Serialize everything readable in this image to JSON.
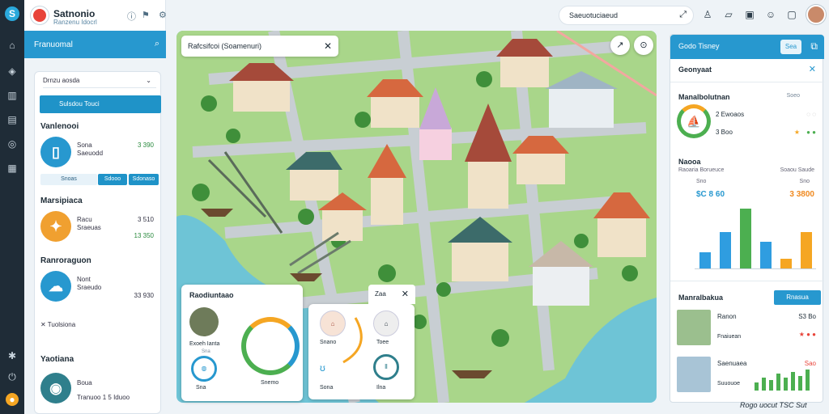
{
  "rail": {
    "icons": [
      "logo-icon",
      "home-icon",
      "layers-icon",
      "chart-icon",
      "bookmark-icon",
      "compass-icon",
      "calendar-icon",
      "settings-icon",
      "power-icon",
      "user-icon"
    ]
  },
  "brand": {
    "title": "Satnonio",
    "subtitle": "Ranzenu Idocrl"
  },
  "sidebar_header": {
    "label": "Franuomal"
  },
  "panel": {
    "select_label": "Drnzu aosda",
    "blue_button": "Sulsdou Touci",
    "section1": "Vanlenooi",
    "item1": {
      "name": "Sona",
      "sub": "Saeuodd",
      "value": "3 390"
    },
    "pills": [
      "Snoas",
      "Sdooo",
      "Sdonaso"
    ],
    "section2": "Marsipiaca",
    "item2": {
      "name": "Racu",
      "sub": "Sraeuas",
      "value": "3 510",
      "value2": "13 350"
    },
    "section3": "Ranroraguon",
    "item3": {
      "name": "Nont",
      "sub": "Sraeudo",
      "value": "33 930"
    },
    "tools": "Tuolsiona",
    "section4": "Yaotiana",
    "item4": {
      "name": "Boua",
      "sub": "Tranuoo 1 5 Iduoo"
    }
  },
  "map": {
    "search_text": "Rafcsifcoi (Soamenuri)"
  },
  "card_left": {
    "title": "Raodiuntaao",
    "thumb1_label": "Exoeh Ianta",
    "thumb1_sub": "Sna",
    "thumb2_label": "Sna",
    "ring_label": "Snemo"
  },
  "card_mid": {
    "title": "Zaa",
    "labels": [
      "Snano",
      "Toee",
      "Sona",
      "Ilna"
    ]
  },
  "top": {
    "search_text": "Saeuotuciaeud"
  },
  "right": {
    "head_title": "Godo Tisney",
    "head_btn": "Sea",
    "sub_title": "Geonyaat",
    "sec1": "Manalbolutnan",
    "gauge_a": "2 Ewoaos",
    "gauge_b": "3 Boo",
    "gauge_a_val": "Soeo",
    "gauge_b_val": "Bee",
    "sec2": "Naooa",
    "sec2_sub": "Raoaria Borueuce",
    "sec2_sub2": "Soaou Saude",
    "chart_left_label": "Sno",
    "chart_left_val": "$C 8 60",
    "chart_right_label": "Sno",
    "chart_right_val": "3 3800",
    "sec3": "Manralbakua",
    "sec3_btn": "Rnasua",
    "item1": {
      "name": "Ranon",
      "sub": "Fnaiuean",
      "value": "S3 Bo"
    },
    "item2": {
      "name": "Saenuaea",
      "sub": "Suuouoe",
      "value": "Sao"
    }
  },
  "footer": "Rogo uocut TSC Sut",
  "chart_data": {
    "type": "bar",
    "categories": [
      "",
      "",
      "",
      "",
      "",
      ""
    ],
    "series": [
      {
        "values": [
          0.25,
          0.55,
          0.9,
          0.4,
          0.15,
          0.55
        ]
      }
    ],
    "colors": [
      "#2f9de0",
      "#2f9de0",
      "#4caf50",
      "#2f9de0",
      "#f5a623",
      "#f5a623"
    ]
  }
}
